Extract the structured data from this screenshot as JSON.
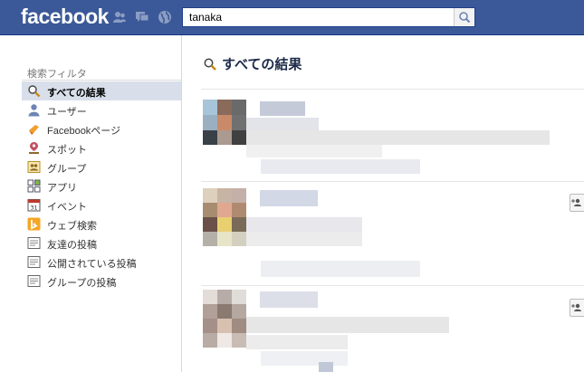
{
  "header": {
    "logo": "facebook",
    "search_value": "tanaka"
  },
  "sidebar": {
    "title": "検索フィルタ",
    "items": [
      {
        "label": "すべての結果",
        "icon": "magnifier-icon"
      },
      {
        "label": "ユーザー",
        "icon": "user-icon"
      },
      {
        "label": "Facebookページ",
        "icon": "flag-icon"
      },
      {
        "label": "スポット",
        "icon": "place-pin-icon"
      },
      {
        "label": "グループ",
        "icon": "group-icon"
      },
      {
        "label": "アプリ",
        "icon": "apps-icon"
      },
      {
        "label": "イベント",
        "icon": "calendar-icon"
      },
      {
        "label": "ウェブ検索",
        "icon": "bing-icon"
      },
      {
        "label": "友達の投稿",
        "icon": "post-icon"
      },
      {
        "label": "公開されている投稿",
        "icon": "post-icon"
      },
      {
        "label": "グループの投稿",
        "icon": "post-icon"
      }
    ]
  },
  "main": {
    "title": "すべての結果"
  },
  "colors": {
    "brand": "#3b5998",
    "active_filter_bg": "#d8dfea",
    "heading": "#1c2a47"
  }
}
